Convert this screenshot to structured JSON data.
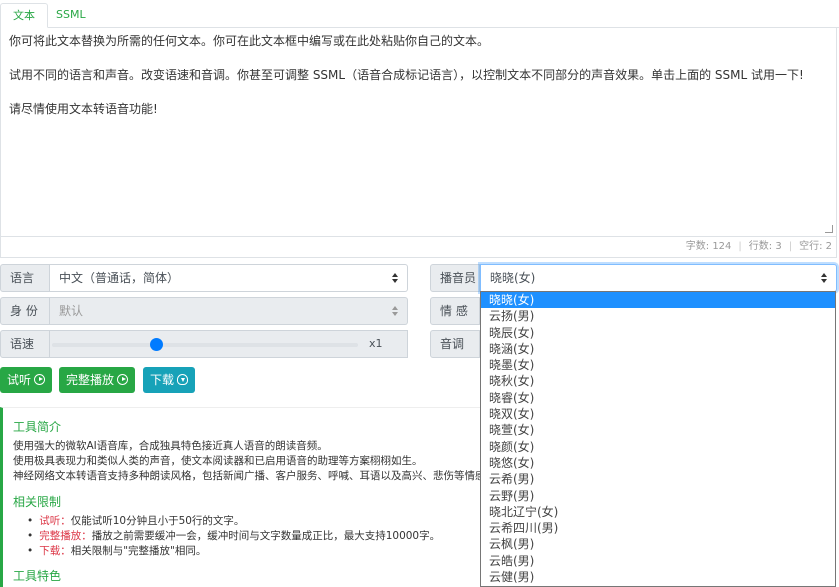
{
  "tabs": [
    {
      "label": "文本",
      "active": true
    },
    {
      "label": "SSML",
      "active": false
    }
  ],
  "editor": {
    "paragraphs": [
      "你可将此文本替换为所需的任何文本。你可在此文本框中编写或在此处粘贴你自己的文本。",
      "试用不同的语言和声音。改变语速和音调。你甚至可调整 SSML（语音合成标记语言），以控制文本不同部分的声音效果。单击上面的 SSML 试用一下!",
      "请尽情使用文本转语音功能!"
    ]
  },
  "stats": {
    "chars_label": "字数: 124",
    "lines_label": "行数: 3",
    "empty_label": "空行: 2",
    "separator": "|"
  },
  "controls": {
    "language_label": "语言",
    "language_value": "中文（普通话，简体）",
    "identity_label": "身 份",
    "identity_value": "默认",
    "speed_label": "语速",
    "speed_value": "x1",
    "speed_fraction": 0.34,
    "voice_label": "播音员",
    "voice_value": "晓晓(女)",
    "emotion_label": "情 感",
    "pitch_label": "音调"
  },
  "buttons": {
    "try_label": "试听",
    "full_label": "完整播放",
    "download_label": "下载"
  },
  "info": {
    "intro_title": "工具简介",
    "intro_lines": [
      "使用强大的微软AI语音库，合成独具特色接近真人语音的朗读音频。",
      "使用极具表现力和类似人类的声音，使文本阅读器和已启用语音的助理等方案栩栩如生。",
      "神经网络文本转语音支持多种朗读风格，包括新闻广播、客户服务、呼喊、耳语以及高兴、悲伤等情感。"
    ],
    "limits_title": "相关限制",
    "limits": [
      {
        "key": "试听：",
        "text": "仅能试听10分钟且小于50行的文字。"
      },
      {
        "key": "完整播放：",
        "text": "播放之前需要缓冲一会，缓冲时间与文字数量成正比，最大支持10000字。"
      },
      {
        "key": "下载：",
        "text": "相关限制与\"完整播放\"相同。"
      }
    ],
    "features_title": "工具特色"
  },
  "voice_options": [
    "晓晓(女)",
    "云扬(男)",
    "晓辰(女)",
    "晓涵(女)",
    "晓墨(女)",
    "晓秋(女)",
    "晓睿(女)",
    "晓双(女)",
    "晓萱(女)",
    "晓颜(女)",
    "晓悠(女)",
    "云希(男)",
    "云野(男)",
    "晓北辽宁(女)",
    "云希四川(男)",
    "云枫(男)",
    "云皓(男)",
    "云健(男)"
  ],
  "voice_selected_index": 0
}
